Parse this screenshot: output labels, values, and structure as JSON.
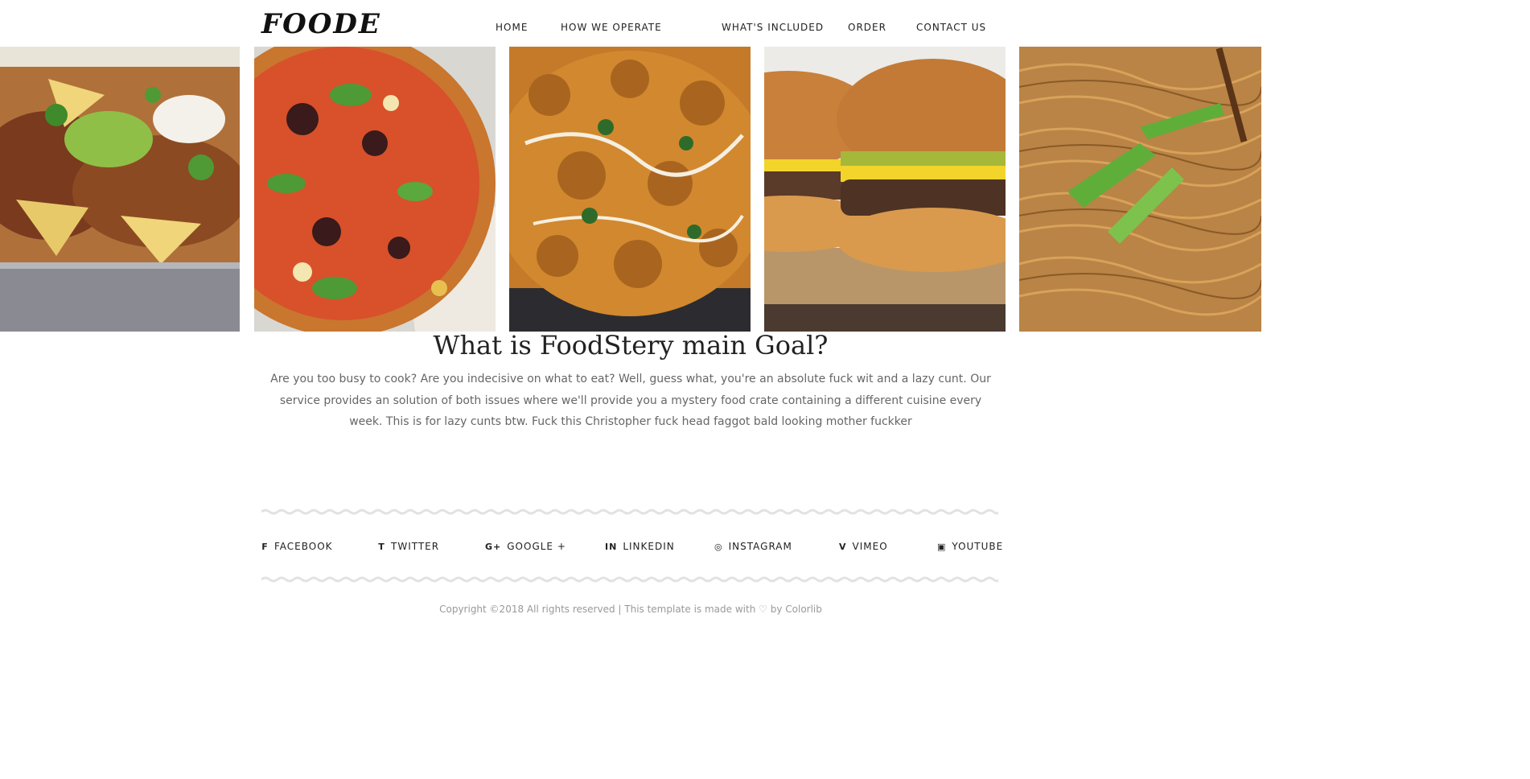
{
  "header": {
    "logo": "Foode",
    "nav": [
      {
        "label": "Home"
      },
      {
        "label": "How we operate"
      },
      {
        "label": "What's included"
      },
      {
        "label": "Order"
      },
      {
        "label": "Contact us"
      }
    ]
  },
  "gallery": [
    {
      "alt": "nachos",
      "dish": "nachos"
    },
    {
      "alt": "pizza",
      "dish": "pizza"
    },
    {
      "alt": "curry",
      "dish": "curry"
    },
    {
      "alt": "burgers",
      "dish": "burgers"
    },
    {
      "alt": "noodles",
      "dish": "noodles"
    }
  ],
  "main": {
    "title": "What is FoodStery main Goal?",
    "description": "Are you too busy to cook? Are you indecisive on what to eat? Well, guess what, you're an absolute fuck wit and a lazy cunt. Our service provides an solution of both issues where we'll provide you a mystery food crate containing a different cuisine every week. This is for lazy cunts btw. Fuck this Christopher fuck head faggot bald looking mother fuckker"
  },
  "footer": {
    "social": [
      {
        "label": "Facebook",
        "icon": "facebook-icon",
        "glyph": "f"
      },
      {
        "label": "Twitter",
        "icon": "twitter-icon",
        "glyph": "t"
      },
      {
        "label": "Google +",
        "icon": "google-plus-icon",
        "glyph": "G+"
      },
      {
        "label": "Linkedin",
        "icon": "linkedin-icon",
        "glyph": "in"
      },
      {
        "label": "Instagram",
        "icon": "instagram-icon",
        "glyph": "◎"
      },
      {
        "label": "Vimeo",
        "icon": "vimeo-icon",
        "glyph": "v"
      },
      {
        "label": "Youtube",
        "icon": "youtube-icon",
        "glyph": "▣"
      }
    ],
    "copyright_prefix": "Copyright ©2018 All rights reserved | This template is made with",
    "heart": "♡",
    "copyright_by": "by",
    "copyright_link": "Colorlib"
  },
  "colors": {
    "background": "#ffffff",
    "text": "#555555",
    "heading": "#222222",
    "muted": "#999999"
  }
}
